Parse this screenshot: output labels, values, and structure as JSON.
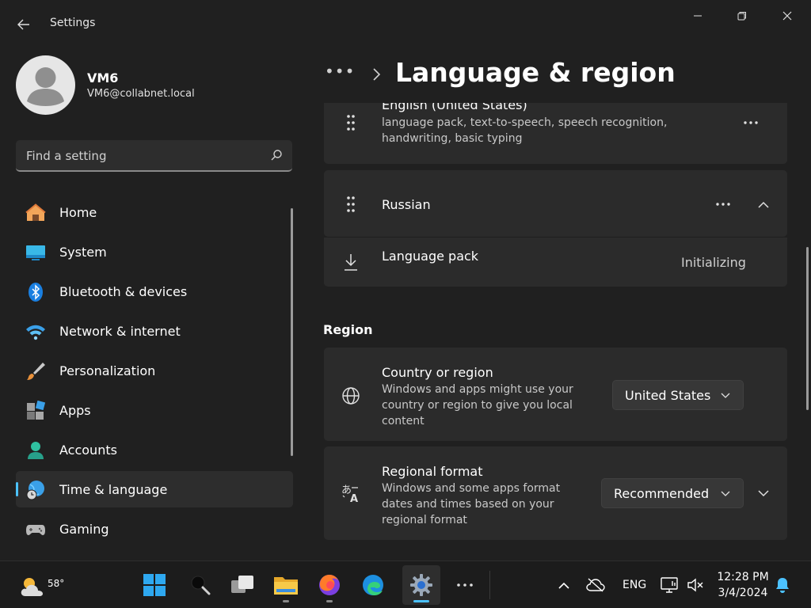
{
  "window": {
    "title": "Settings"
  },
  "profile": {
    "name": "VM6",
    "email": "VM6@collabnet.local"
  },
  "search": {
    "placeholder": "Find a setting"
  },
  "nav": {
    "items": [
      {
        "label": "Home",
        "icon": "home-icon"
      },
      {
        "label": "System",
        "icon": "system-icon"
      },
      {
        "label": "Bluetooth & devices",
        "icon": "bluetooth-icon"
      },
      {
        "label": "Network & internet",
        "icon": "wifi-icon"
      },
      {
        "label": "Personalization",
        "icon": "brush-icon"
      },
      {
        "label": "Apps",
        "icon": "apps-icon"
      },
      {
        "label": "Accounts",
        "icon": "accounts-icon"
      },
      {
        "label": "Time & language",
        "icon": "time-language-icon",
        "active": true
      },
      {
        "label": "Gaming",
        "icon": "gamepad-icon"
      }
    ]
  },
  "header": {
    "more": "•••",
    "title": "Language & region"
  },
  "languages": {
    "english": {
      "title": "English (United States)",
      "desc": "language pack, text-to-speech, speech recognition, handwriting, basic typing"
    },
    "russian": {
      "title": "Russian"
    },
    "language_pack": {
      "title": "Language pack",
      "status": "Initializing"
    }
  },
  "region": {
    "section_title": "Region",
    "country": {
      "title": "Country or region",
      "desc": "Windows and apps might use your country or region to give you local content",
      "value": "United States"
    },
    "format": {
      "title": "Regional format",
      "desc": "Windows and some apps format dates and times based on your regional format",
      "value": "Recommended"
    }
  },
  "taskbar": {
    "weather": "58°",
    "language": "ENG",
    "time": "12:28 PM",
    "date": "3/4/2024"
  },
  "colors": {
    "accent": "#4cc2ff",
    "background": "#202020",
    "card": "#2b2b2b"
  }
}
